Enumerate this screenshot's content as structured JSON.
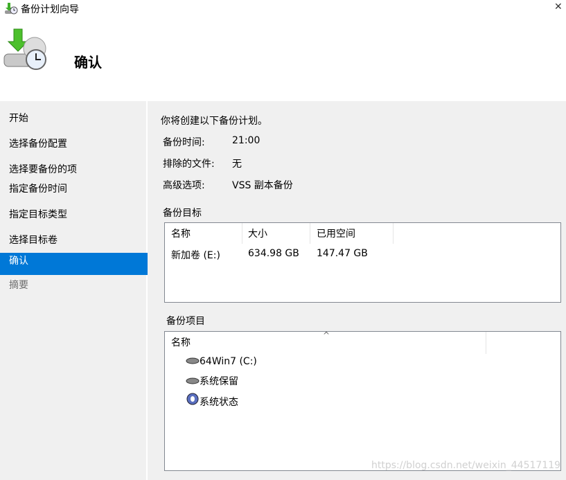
{
  "window": {
    "title": "备份计划向导",
    "close": "✕"
  },
  "header": {
    "title": "确认"
  },
  "nav": {
    "items": [
      {
        "label": "开始"
      },
      {
        "label": "选择备份配置"
      },
      {
        "label": "选择要备份的项"
      },
      {
        "label": "指定备份时间"
      },
      {
        "label": "指定目标类型"
      },
      {
        "label": "选择目标卷"
      },
      {
        "label": "确认"
      },
      {
        "label": "摘要"
      }
    ]
  },
  "main": {
    "intro": "你将创建以下备份计划。",
    "details": [
      {
        "label": "备份时间:",
        "value": "21:00"
      },
      {
        "label": "排除的文件:",
        "value": "无"
      },
      {
        "label": "高级选项:",
        "value": "VSS 副本备份"
      }
    ],
    "target": {
      "heading": "备份目标",
      "columns": [
        "名称",
        "大小",
        "已用空间"
      ],
      "rows": [
        [
          "新加卷 (E:)",
          "634.98 GB",
          "147.47 GB"
        ]
      ]
    },
    "items": {
      "heading": "备份项目",
      "column": "名称",
      "sort": "^",
      "rows": [
        {
          "label": "64Win7  (C:)",
          "icon": "drive-icon"
        },
        {
          "label": "系统保留",
          "icon": "drive-icon"
        },
        {
          "label": "系统状态",
          "icon": "system-state-icon"
        }
      ]
    }
  },
  "watermark": "https://blog.csdn.net/weixin_44517119"
}
